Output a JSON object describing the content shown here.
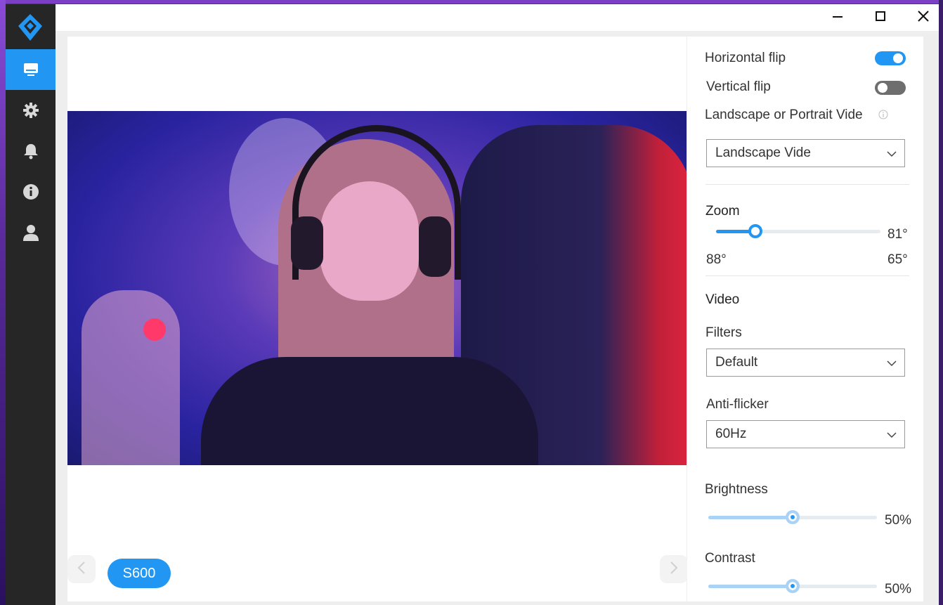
{
  "sidebar": {
    "items": [
      {
        "icon": "monitor-icon",
        "active": true
      },
      {
        "icon": "gear-icon",
        "active": false
      },
      {
        "icon": "bell-icon",
        "active": false
      },
      {
        "icon": "info-icon",
        "active": false
      },
      {
        "icon": "user-icon",
        "active": false
      }
    ]
  },
  "window_controls": {
    "minimize": "minimize-icon",
    "maximize": "maximize-icon",
    "close": "close-icon"
  },
  "preview": {
    "device_label": "S600"
  },
  "settings": {
    "horizontal_flip": {
      "label": "Horizontal flip",
      "on": true
    },
    "vertical_flip": {
      "label": "Vertical flip",
      "on": false
    },
    "orientation": {
      "label": "Landscape or Portrait Vide",
      "value": "Landscape Vide"
    },
    "zoom": {
      "label": "Zoom",
      "value": "81°",
      "min_label": "88°",
      "max_label": "65°",
      "level": 0.24
    },
    "video_heading": "Video",
    "filters": {
      "label": "Filters",
      "value": "Default"
    },
    "anti_flicker": {
      "label": "Anti-flicker",
      "value": "60Hz"
    },
    "brightness": {
      "label": "Brightness",
      "value": "50%",
      "level": 0.5
    },
    "contrast": {
      "label": "Contrast",
      "value": "50%",
      "level": 0.5
    }
  },
  "colors": {
    "accent": "#2196f3",
    "sidebar_bg": "#262626",
    "toggle_off": "#6e6e6e"
  }
}
